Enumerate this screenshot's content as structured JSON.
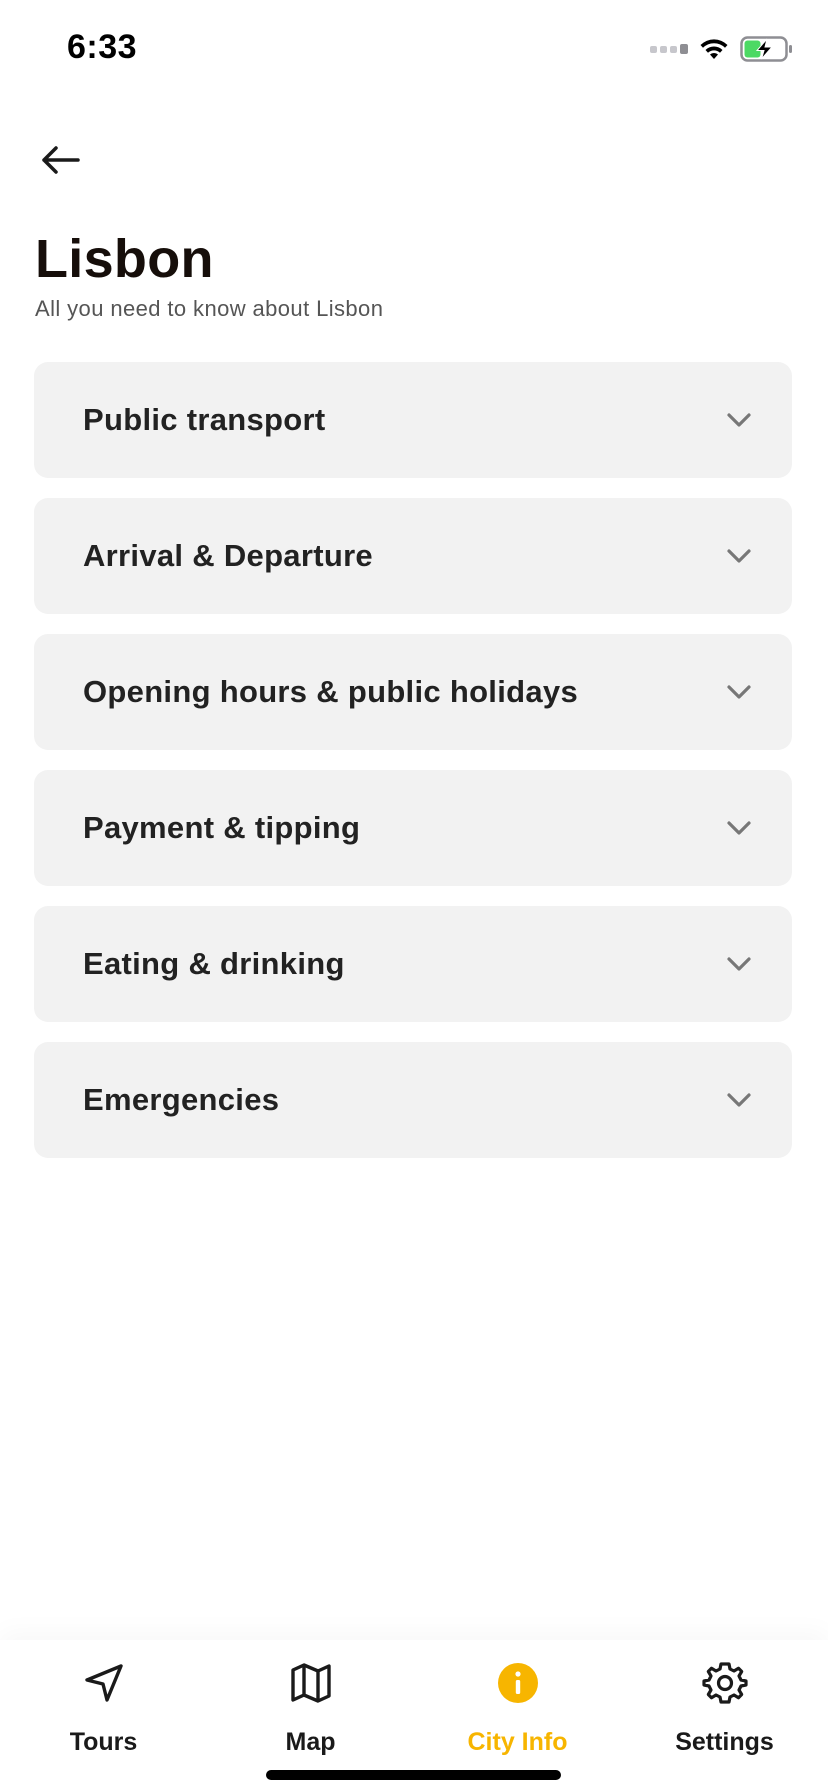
{
  "status_bar": {
    "time": "6:33"
  },
  "header": {
    "title": "Lisbon",
    "subtitle": "All you need to know about Lisbon"
  },
  "sections": [
    {
      "label": "Public transport"
    },
    {
      "label": "Arrival & Departure"
    },
    {
      "label": "Opening hours & public holidays"
    },
    {
      "label": "Payment & tipping"
    },
    {
      "label": "Eating & drinking"
    },
    {
      "label": "Emergencies"
    }
  ],
  "tab_bar": {
    "tabs": [
      {
        "label": "Tours",
        "icon": "navigation-arrow-icon"
      },
      {
        "label": "Map",
        "icon": "map-icon"
      },
      {
        "label": "City Info",
        "icon": "info-icon",
        "active": true
      },
      {
        "label": "Settings",
        "icon": "gear-icon"
      }
    ]
  },
  "colors": {
    "accent": "#f7b500",
    "card_background": "#f2f2f2",
    "battery_green": "#4cd964"
  }
}
